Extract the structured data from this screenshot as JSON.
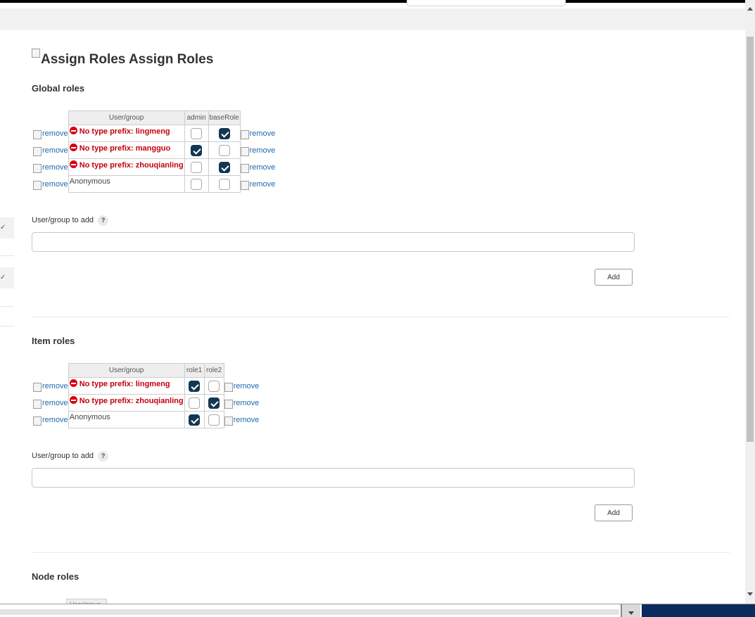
{
  "page": {
    "title_img_alt": "Assign Roles",
    "title": "Assign Roles"
  },
  "global": {
    "title": "Global roles",
    "header_user": "User/group",
    "roles": [
      "admin",
      "baseRole"
    ],
    "rows": [
      {
        "name": "No type prefix: lingmeng",
        "warning": true,
        "checks": [
          false,
          true
        ]
      },
      {
        "name": "No type prefix: mangguo",
        "warning": true,
        "checks": [
          true,
          false
        ]
      },
      {
        "name": "No type prefix: zhouqianling",
        "warning": true,
        "checks": [
          false,
          true
        ]
      },
      {
        "name": "Anonymous",
        "warning": false,
        "checks": [
          false,
          false
        ]
      }
    ],
    "add_label": "User/group to add",
    "help": "?",
    "add_button": "Add"
  },
  "item": {
    "title": "Item roles",
    "header_user": "User/group",
    "roles": [
      "role1",
      "role2"
    ],
    "rows": [
      {
        "name": "No type prefix: lingmeng",
        "warning": true,
        "checks": [
          true,
          false
        ]
      },
      {
        "name": "No type prefix: zhouqianling",
        "warning": true,
        "checks": [
          false,
          true
        ]
      },
      {
        "name": "Anonymous",
        "warning": false,
        "checks": [
          true,
          false
        ]
      }
    ],
    "add_label": "User/group to add",
    "help": "?",
    "add_button": "Add"
  },
  "node": {
    "title": "Node roles",
    "header_user": "User/group"
  },
  "remove_alt": "remove",
  "sidebar": {
    "chevrons": [
      "✓",
      "✓"
    ]
  },
  "colors": {
    "checkbox_checked": "#123752",
    "warning_red": "#c4000e",
    "link_blue": "#1f67b3",
    "header_gray": "#eeeeee",
    "taskbar_navy": "#0a2b5c"
  },
  "icons": [
    "warning-icon",
    "broken-image-icon",
    "checkmark-icon",
    "help-icon"
  ]
}
